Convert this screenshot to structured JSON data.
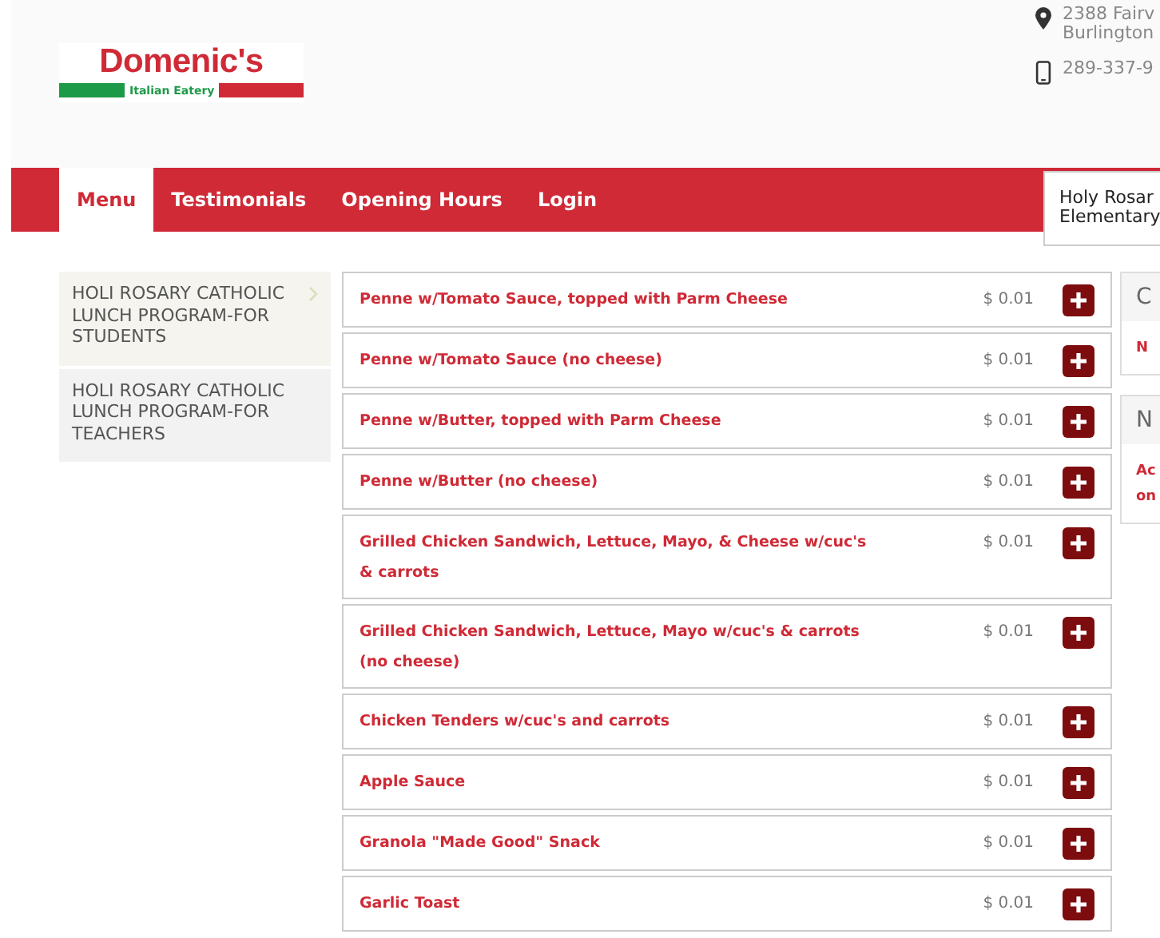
{
  "logo": {
    "name": "Domenic's",
    "tagline": "Italian Eatery"
  },
  "contact": {
    "address_lines": [
      "2388 Fairv",
      "Burlington"
    ],
    "phone": "289-337-9"
  },
  "nav": [
    {
      "label": "Menu",
      "selected": true
    },
    {
      "label": "Testimonials",
      "selected": false
    },
    {
      "label": "Opening Hours",
      "selected": false
    },
    {
      "label": "Login",
      "selected": false
    }
  ],
  "school_select": {
    "value_lines": [
      "Holy Rosar",
      "Elementary"
    ]
  },
  "categories": [
    {
      "label": "HOLI ROSARY CATHOLIC LUNCH PROGRAM-FOR STUDENTS",
      "selected": true
    },
    {
      "label": "HOLI ROSARY CATHOLIC LUNCH PROGRAM-FOR TEACHERS",
      "selected": false
    }
  ],
  "items": [
    {
      "name": "Penne w/Tomato Sauce, topped with Parm Cheese",
      "price": "$ 0.01"
    },
    {
      "name": "Penne w/Tomato Sauce (no cheese)",
      "price": "$ 0.01"
    },
    {
      "name": "Penne w/Butter, topped with Parm Cheese",
      "price": "$ 0.01"
    },
    {
      "name": "Penne w/Butter (no cheese)",
      "price": "$ 0.01"
    },
    {
      "name": "Grilled Chicken Sandwich, Lettuce, Mayo, & Cheese w/cuc's & carrots",
      "price": "$ 0.01"
    },
    {
      "name": "Grilled Chicken Sandwich, Lettuce, Mayo w/cuc's & carrots (no cheese)",
      "price": "$ 0.01"
    },
    {
      "name": "Chicken Tenders w/cuc's and carrots",
      "price": "$ 0.01"
    },
    {
      "name": "Apple Sauce",
      "price": "$ 0.01"
    },
    {
      "name": "Granola \"Made Good\" Snack",
      "price": "$ 0.01"
    },
    {
      "name": "Garlic Toast",
      "price": "$ 0.01"
    }
  ],
  "panels": [
    {
      "title": "C",
      "body_lines": [
        "N"
      ]
    },
    {
      "title": "N",
      "body_lines": [
        "Ac",
        "on"
      ]
    }
  ]
}
